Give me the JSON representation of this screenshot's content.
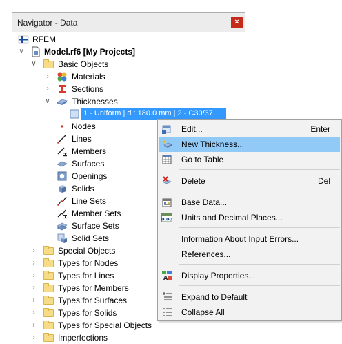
{
  "window": {
    "title": "Navigator - Data",
    "close_glyph": "×"
  },
  "tree": {
    "root": "RFEM",
    "model": "Model.rf6 [My Projects]",
    "basic_objects": "Basic Objects",
    "materials": "Materials",
    "sections": "Sections",
    "thicknesses": "Thicknesses",
    "selected_item": "1 - Uniform | d : 180.0 mm | 2 - C30/37",
    "nodes": "Nodes",
    "lines": "Lines",
    "members": "Members",
    "surfaces": "Surfaces",
    "openings": "Openings",
    "solids": "Solids",
    "line_sets": "Line Sets",
    "member_sets": "Member Sets",
    "surface_sets": "Surface Sets",
    "solid_sets": "Solid Sets",
    "special_objects": "Special Objects",
    "types_nodes": "Types for Nodes",
    "types_lines": "Types for Lines",
    "types_members": "Types for Members",
    "types_surfaces": "Types for Surfaces",
    "types_solids": "Types for Solids",
    "types_special": "Types for Special Objects",
    "imperfections": "Imperfections"
  },
  "context_menu": {
    "edit": "Edit...",
    "edit_key": "Enter",
    "new_thickness": "New Thickness...",
    "go_to_table": "Go to Table",
    "delete": "Delete",
    "delete_key": "Del",
    "base_data": "Base Data...",
    "units": "Units and Decimal Places...",
    "info_errors": "Information About Input Errors...",
    "references": "References...",
    "display_props": "Display Properties...",
    "expand_default": "Expand to Default",
    "collapse_all": "Collapse All",
    "units_icon_text": "0,00"
  },
  "colors": {
    "selection": "#3399ff",
    "menu_hover": "#91c9f7",
    "close_red": "#c42b1c"
  }
}
